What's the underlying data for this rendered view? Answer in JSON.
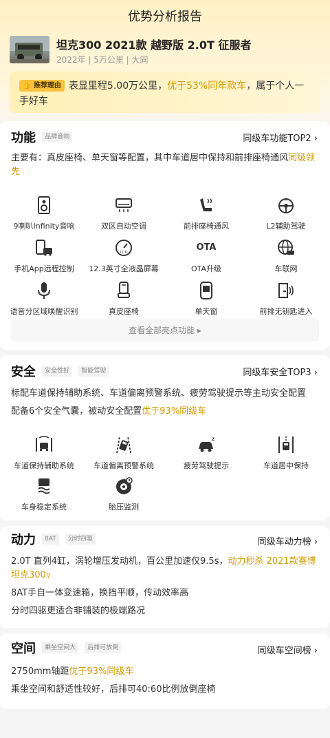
{
  "header": {
    "title": "优势分析报告",
    "car_title": "坦克300 2021款 越野版 2.0T 征服者",
    "car_sub": "2022年 | 5万公里 | 大同"
  },
  "reason": {
    "badge": "推荐理由",
    "text_before": "表显里程5.00万公里，",
    "highlight": "优于53%同年款车",
    "text_after": "，属于个人一手好车"
  },
  "features": {
    "title": "功能",
    "tag": "品牌音响",
    "rank": "同级车功能TOP2",
    "desc_before": "主要有：真皮座椅、单天窗等配置，其中车道居中保持和前排座椅通风",
    "desc_highlight": "同级领先",
    "items": [
      {
        "label": "9喇叭Infinity音响",
        "icon": "speaker-icon"
      },
      {
        "label": "双区自动空调",
        "icon": "air-conditioner-icon"
      },
      {
        "label": "前排座椅通风",
        "icon": "seat-ventilation-icon"
      },
      {
        "label": "L2辅助驾驶",
        "icon": "steering-wheel-icon"
      },
      {
        "label": "手机App远程控制",
        "icon": "phone-car-icon"
      },
      {
        "label": "12.3英寸全液晶屏幕",
        "icon": "lcd-gauge-icon"
      },
      {
        "label": "OTA升级",
        "icon": "ota-icon"
      },
      {
        "label": "车联网",
        "icon": "globe-icon"
      },
      {
        "label": "语音分区域唤醒识别",
        "icon": "microphone-icon"
      },
      {
        "label": "真皮座椅",
        "icon": "leather-seat-icon"
      },
      {
        "label": "单天窗",
        "icon": "sunroof-icon"
      },
      {
        "label": "前排无钥匙进入",
        "icon": "keyless-door-icon"
      }
    ],
    "ota_glyph": "OTA",
    "more": "查看全部亮点功能"
  },
  "safety": {
    "title": "安全",
    "tags": [
      "安全性好",
      "智能驾驶"
    ],
    "rank": "同级车安全TOP3",
    "line1": "标配车道保持辅助系统、车道偏离预警系统、疲劳驾驶提示等主动安全配置",
    "line2_before": "配备6个安全气囊，被动安全配置",
    "line2_highlight": "优于93%同级车",
    "items": [
      {
        "label": "车道保持辅助系统",
        "icon": "lane-keep-icon"
      },
      {
        "label": "车道偏离预警系统",
        "icon": "lane-departure-icon"
      },
      {
        "label": "疲劳驾驶提示",
        "icon": "fatigue-icon"
      },
      {
        "label": "车道居中保持",
        "icon": "lane-center-icon"
      },
      {
        "label": "车身稳定系统",
        "icon": "stability-icon"
      },
      {
        "label": "胎压监测",
        "icon": "tire-pressure-icon"
      }
    ]
  },
  "power": {
    "title": "动力",
    "tags": [
      "8AT",
      "分时四驱"
    ],
    "rank": "同级车动力榜",
    "line1_before": "2.0T 直列4缸，涡轮增压发动机，百公里加速仅9.5s，",
    "line1_highlight": "动力秒杀 2021款赛博坦克300",
    "line2": "8AT手自一体变速箱，换挡平顺，传动效率高",
    "line3": "分时四驱更适合非铺装的极端路况"
  },
  "space": {
    "title": "空间",
    "tags": [
      "乘坐空间大",
      "后排可放倒"
    ],
    "rank": "同级车空间榜",
    "line1_before": "2750mm轴距",
    "line1_highlight": "优于93%同级车",
    "line2": "乘坐空间和舒适性较好，后排可40:60比例放倒座椅"
  },
  "colors": {
    "accent": "#d29a00",
    "badge": "#f9c23c",
    "header_bg": "#fff1c6"
  }
}
